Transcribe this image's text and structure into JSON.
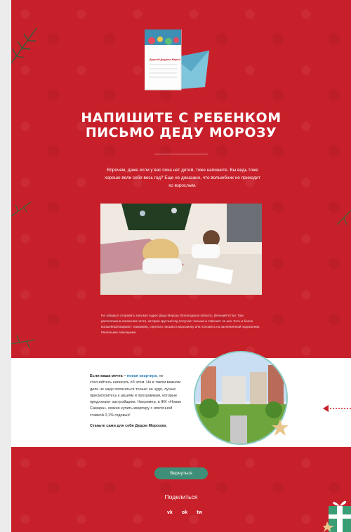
{
  "headline": {
    "line1": "НАПИШИТЕ С РЕБЕНКОМ",
    "line2": "ПИСЬМО ДЕДУ МОРОЗУ"
  },
  "intro": "Впрочем, даже если у вас пока нет детей, тоже напишите. Вы ведь тоже хорошо вели себя весь год? Еще не доказано, что волшебник не приходит ко взрослым.",
  "envelope_caption": "Дорогой Дедушка Мороз!",
  "bottom_text": "Не забудьте отправить письмо! Адрес Деда Мороза: Вологодская область, Великий Устюг. Там расположена сказочная почта, которая круглый год получает письма и отвечает на них. Есть и более волшебный вариант: например, спрятать письмо в морозилку или положить на заснеженный подоконник. Маленькие помощники",
  "promo": {
    "lead": "Если ваша мечта –",
    "link": "новая квартира",
    "text": ", не стесняйтесь написать об этом. Но в таком важном деле не надо полагаться только на чудо, лучше присмотритесь к акциям и программам, которые предлагают застройщики. Например, в ЖК «Новая Самара», можно купить квартиру с ипотечной ставкой 0,1% годовых!",
    "cta": "Станьте сами для себя Дедом Морозом."
  },
  "back_button": "Вернуться",
  "share_label": "Поделиться",
  "socials": [
    "вк-icon",
    "ok-icon",
    "twitter-icon"
  ],
  "colors": {
    "background": "#c8202a",
    "button": "#3f8f78",
    "link": "#2c7fb8"
  }
}
